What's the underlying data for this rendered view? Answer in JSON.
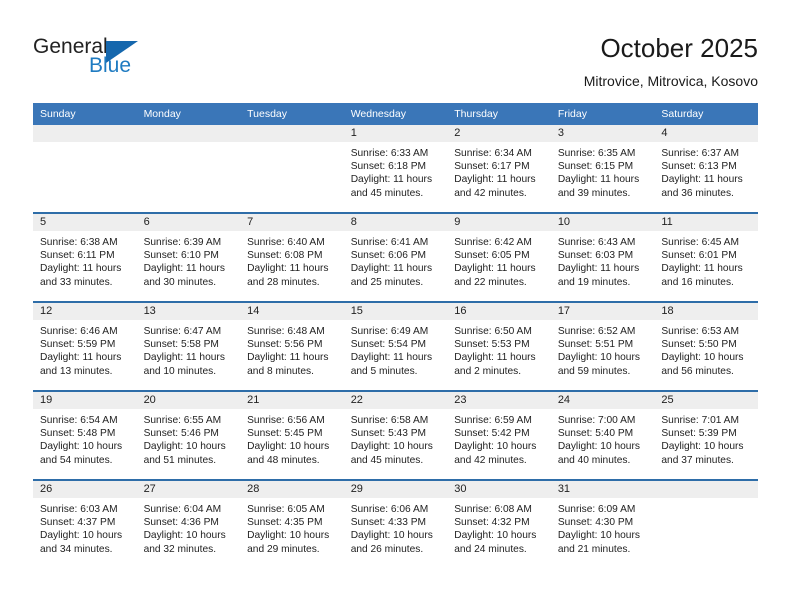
{
  "brand": {
    "name_part1": "General",
    "name_part2": "Blue",
    "logo_icon": "triangle-logo-icon"
  },
  "header": {
    "title": "October 2025",
    "subtitle": "Mitrovice, Mitrovica, Kosovo"
  },
  "calendar": {
    "columns": [
      "Sunday",
      "Monday",
      "Tuesday",
      "Wednesday",
      "Thursday",
      "Friday",
      "Saturday"
    ],
    "accent_color": "#3a76b8",
    "grid_line_color": "#2e6da8",
    "daynum_band_color": "#eeeeee",
    "weeks": [
      [
        {
          "day": "",
          "blank": true
        },
        {
          "day": "",
          "blank": true
        },
        {
          "day": "",
          "blank": true
        },
        {
          "day": "1",
          "sunrise": "Sunrise: 6:33 AM",
          "sunset": "Sunset: 6:18 PM",
          "daylight1": "Daylight: 11 hours",
          "daylight2": "and 45 minutes."
        },
        {
          "day": "2",
          "sunrise": "Sunrise: 6:34 AM",
          "sunset": "Sunset: 6:17 PM",
          "daylight1": "Daylight: 11 hours",
          "daylight2": "and 42 minutes."
        },
        {
          "day": "3",
          "sunrise": "Sunrise: 6:35 AM",
          "sunset": "Sunset: 6:15 PM",
          "daylight1": "Daylight: 11 hours",
          "daylight2": "and 39 minutes."
        },
        {
          "day": "4",
          "sunrise": "Sunrise: 6:37 AM",
          "sunset": "Sunset: 6:13 PM",
          "daylight1": "Daylight: 11 hours",
          "daylight2": "and 36 minutes."
        }
      ],
      [
        {
          "day": "5",
          "sunrise": "Sunrise: 6:38 AM",
          "sunset": "Sunset: 6:11 PM",
          "daylight1": "Daylight: 11 hours",
          "daylight2": "and 33 minutes."
        },
        {
          "day": "6",
          "sunrise": "Sunrise: 6:39 AM",
          "sunset": "Sunset: 6:10 PM",
          "daylight1": "Daylight: 11 hours",
          "daylight2": "and 30 minutes."
        },
        {
          "day": "7",
          "sunrise": "Sunrise: 6:40 AM",
          "sunset": "Sunset: 6:08 PM",
          "daylight1": "Daylight: 11 hours",
          "daylight2": "and 28 minutes."
        },
        {
          "day": "8",
          "sunrise": "Sunrise: 6:41 AM",
          "sunset": "Sunset: 6:06 PM",
          "daylight1": "Daylight: 11 hours",
          "daylight2": "and 25 minutes."
        },
        {
          "day": "9",
          "sunrise": "Sunrise: 6:42 AM",
          "sunset": "Sunset: 6:05 PM",
          "daylight1": "Daylight: 11 hours",
          "daylight2": "and 22 minutes."
        },
        {
          "day": "10",
          "sunrise": "Sunrise: 6:43 AM",
          "sunset": "Sunset: 6:03 PM",
          "daylight1": "Daylight: 11 hours",
          "daylight2": "and 19 minutes."
        },
        {
          "day": "11",
          "sunrise": "Sunrise: 6:45 AM",
          "sunset": "Sunset: 6:01 PM",
          "daylight1": "Daylight: 11 hours",
          "daylight2": "and 16 minutes."
        }
      ],
      [
        {
          "day": "12",
          "sunrise": "Sunrise: 6:46 AM",
          "sunset": "Sunset: 5:59 PM",
          "daylight1": "Daylight: 11 hours",
          "daylight2": "and 13 minutes."
        },
        {
          "day": "13",
          "sunrise": "Sunrise: 6:47 AM",
          "sunset": "Sunset: 5:58 PM",
          "daylight1": "Daylight: 11 hours",
          "daylight2": "and 10 minutes."
        },
        {
          "day": "14",
          "sunrise": "Sunrise: 6:48 AM",
          "sunset": "Sunset: 5:56 PM",
          "daylight1": "Daylight: 11 hours",
          "daylight2": "and 8 minutes."
        },
        {
          "day": "15",
          "sunrise": "Sunrise: 6:49 AM",
          "sunset": "Sunset: 5:54 PM",
          "daylight1": "Daylight: 11 hours",
          "daylight2": "and 5 minutes."
        },
        {
          "day": "16",
          "sunrise": "Sunrise: 6:50 AM",
          "sunset": "Sunset: 5:53 PM",
          "daylight1": "Daylight: 11 hours",
          "daylight2": "and 2 minutes."
        },
        {
          "day": "17",
          "sunrise": "Sunrise: 6:52 AM",
          "sunset": "Sunset: 5:51 PM",
          "daylight1": "Daylight: 10 hours",
          "daylight2": "and 59 minutes."
        },
        {
          "day": "18",
          "sunrise": "Sunrise: 6:53 AM",
          "sunset": "Sunset: 5:50 PM",
          "daylight1": "Daylight: 10 hours",
          "daylight2": "and 56 minutes."
        }
      ],
      [
        {
          "day": "19",
          "sunrise": "Sunrise: 6:54 AM",
          "sunset": "Sunset: 5:48 PM",
          "daylight1": "Daylight: 10 hours",
          "daylight2": "and 54 minutes."
        },
        {
          "day": "20",
          "sunrise": "Sunrise: 6:55 AM",
          "sunset": "Sunset: 5:46 PM",
          "daylight1": "Daylight: 10 hours",
          "daylight2": "and 51 minutes."
        },
        {
          "day": "21",
          "sunrise": "Sunrise: 6:56 AM",
          "sunset": "Sunset: 5:45 PM",
          "daylight1": "Daylight: 10 hours",
          "daylight2": "and 48 minutes."
        },
        {
          "day": "22",
          "sunrise": "Sunrise: 6:58 AM",
          "sunset": "Sunset: 5:43 PM",
          "daylight1": "Daylight: 10 hours",
          "daylight2": "and 45 minutes."
        },
        {
          "day": "23",
          "sunrise": "Sunrise: 6:59 AM",
          "sunset": "Sunset: 5:42 PM",
          "daylight1": "Daylight: 10 hours",
          "daylight2": "and 42 minutes."
        },
        {
          "day": "24",
          "sunrise": "Sunrise: 7:00 AM",
          "sunset": "Sunset: 5:40 PM",
          "daylight1": "Daylight: 10 hours",
          "daylight2": "and 40 minutes."
        },
        {
          "day": "25",
          "sunrise": "Sunrise: 7:01 AM",
          "sunset": "Sunset: 5:39 PM",
          "daylight1": "Daylight: 10 hours",
          "daylight2": "and 37 minutes."
        }
      ],
      [
        {
          "day": "26",
          "sunrise": "Sunrise: 6:03 AM",
          "sunset": "Sunset: 4:37 PM",
          "daylight1": "Daylight: 10 hours",
          "daylight2": "and 34 minutes."
        },
        {
          "day": "27",
          "sunrise": "Sunrise: 6:04 AM",
          "sunset": "Sunset: 4:36 PM",
          "daylight1": "Daylight: 10 hours",
          "daylight2": "and 32 minutes."
        },
        {
          "day": "28",
          "sunrise": "Sunrise: 6:05 AM",
          "sunset": "Sunset: 4:35 PM",
          "daylight1": "Daylight: 10 hours",
          "daylight2": "and 29 minutes."
        },
        {
          "day": "29",
          "sunrise": "Sunrise: 6:06 AM",
          "sunset": "Sunset: 4:33 PM",
          "daylight1": "Daylight: 10 hours",
          "daylight2": "and 26 minutes."
        },
        {
          "day": "30",
          "sunrise": "Sunrise: 6:08 AM",
          "sunset": "Sunset: 4:32 PM",
          "daylight1": "Daylight: 10 hours",
          "daylight2": "and 24 minutes."
        },
        {
          "day": "31",
          "sunrise": "Sunrise: 6:09 AM",
          "sunset": "Sunset: 4:30 PM",
          "daylight1": "Daylight: 10 hours",
          "daylight2": "and 21 minutes."
        },
        {
          "day": "",
          "blank": true
        }
      ]
    ]
  }
}
